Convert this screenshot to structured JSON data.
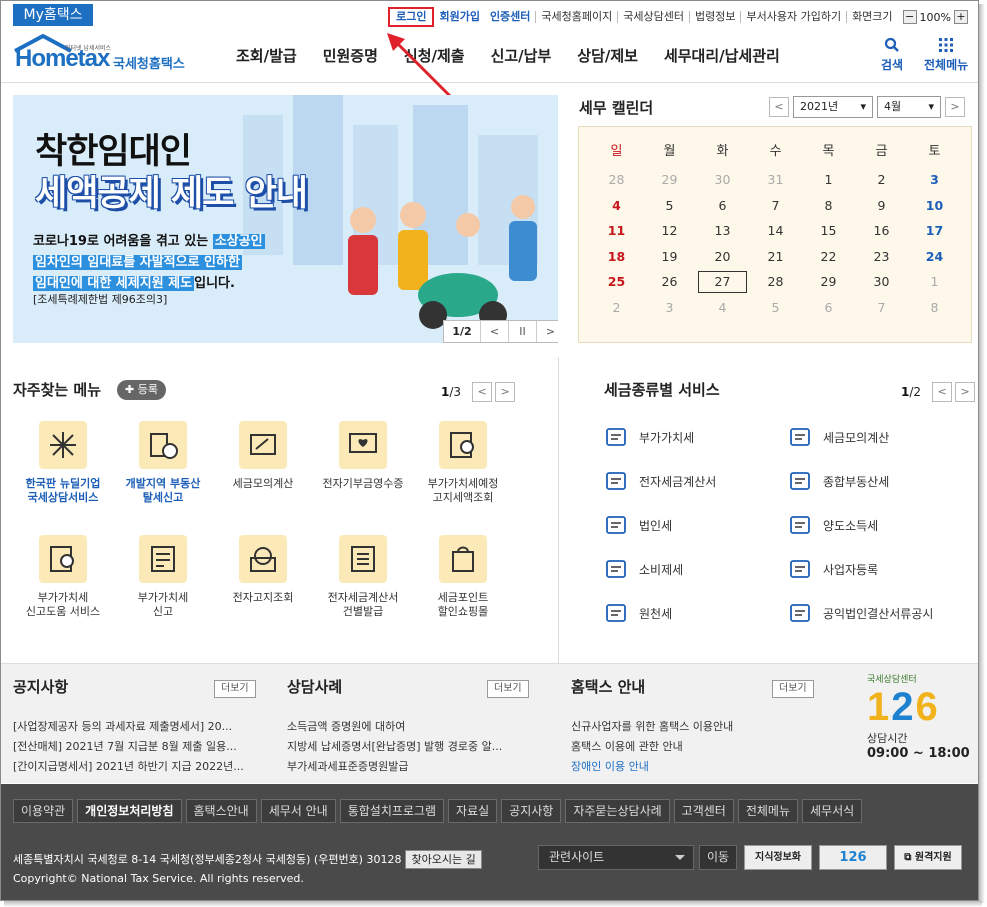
{
  "util": {
    "my_home": "My홈택스",
    "login": "로그인",
    "signup": "회원가입",
    "cert_center": "인증센터",
    "links": [
      "국세청홈페이지",
      "국세상담센터",
      "법령정보",
      "부서사용자 가입하기",
      "화면크기"
    ],
    "zoom": "100%"
  },
  "logo": {
    "brand": "Hometax",
    "sub": "국세청홈택스",
    "tiny": "인터넷 납세서비스"
  },
  "nav": [
    "조회/발급",
    "민원증명",
    "신청/제출",
    "신고/납부",
    "상담/제보",
    "세무대리/납세관리"
  ],
  "header_icons": {
    "search": "검색",
    "all_menu": "전체메뉴"
  },
  "banner": {
    "title1": "착한임대인",
    "title2": "세액공제 제도 안내",
    "line1a": "코로나19로 어려움을 겪고 있는 ",
    "line1b": "소상공인",
    "line2": "임차인의 임대료를 자발적으로 인하한",
    "line3a": "임대인에 대한 세제지원 제도",
    "line3b": "입니다.",
    "law": "[조세특례제한법 제96조의3]",
    "page": "1/2"
  },
  "calendar": {
    "title": "세무 캘린더",
    "year": "2021년",
    "month": "4월",
    "weekdays": [
      "일",
      "월",
      "화",
      "수",
      "목",
      "금",
      "토"
    ],
    "days": [
      [
        "28",
        "29",
        "30",
        "31",
        "1",
        "2",
        "3"
      ],
      [
        "4",
        "5",
        "6",
        "7",
        "8",
        "9",
        "10"
      ],
      [
        "11",
        "12",
        "13",
        "14",
        "15",
        "16",
        "17"
      ],
      [
        "18",
        "19",
        "20",
        "21",
        "22",
        "23",
        "24"
      ],
      [
        "25",
        "26",
        "27",
        "28",
        "29",
        "30",
        "1"
      ],
      [
        "2",
        "3",
        "4",
        "5",
        "6",
        "7",
        "8"
      ]
    ],
    "today": "27"
  },
  "freq": {
    "title": "자주찾는 메뉴",
    "add": "등록",
    "page_cur": "1",
    "page_total": "/3",
    "items": [
      "한국판 뉴딜기업\n국세상담서비스",
      "개발지역 부동산\n탈세신고",
      "세금모의계산",
      "전자기부금영수증",
      "부가가치세예정\n고지세액조회",
      "부가가치세\n신고도움 서비스",
      "부가가치세\n신고",
      "전자고지조회",
      "전자세금계산서\n건별발급",
      "세금포인트\n할인쇼핑몰"
    ]
  },
  "tax": {
    "title": "세금종류별 서비스",
    "page_cur": "1",
    "page_total": "/2",
    "left": [
      "부가가치세",
      "전자세금계산서",
      "법인세",
      "소비제세",
      "원천세"
    ],
    "right": [
      "세금모의계산",
      "종합부동산세",
      "양도소득세",
      "사업자등록",
      "공익법인결산서류공시"
    ]
  },
  "notice": {
    "title": "공지사항",
    "more": "더보기",
    "items": [
      "[사업장제공자 등의 과세자료 제출명세서] 20...",
      "[전산매체] 2021년 7월 지급분 8월 제출 일용...",
      "[간이지급명세서] 2021년 하반기 지급 2022년..."
    ]
  },
  "cases": {
    "title": "상담사례",
    "more": "더보기",
    "items": [
      "소득금액 증명원에 대하여",
      "지방세 납세증명서[완납증명] 발행 경로중 알...",
      "부가세과세표준증명원발급"
    ]
  },
  "guide": {
    "title": "홈택스 안내",
    "more": "더보기",
    "items": [
      "신규사업자를 위한 홈택스 이용안내",
      "홈택스 이용에 관한 안내",
      "장애인 이용 안내"
    ]
  },
  "center": {
    "small": "국세상담센터",
    "num_a": "1",
    "num_b": "2",
    "num_c": "6",
    "hours_label": "상담시간",
    "hours": "09:00 ~ 18:00"
  },
  "footer": {
    "links": [
      "이용약관",
      "개인정보처리방침",
      "홈택스안내",
      "세무서 안내",
      "통합설치프로그램",
      "자료실",
      "공지사항",
      "자주묻는상담사례",
      "고객센터",
      "전체메뉴",
      "세무서식"
    ],
    "address": "세종특별자치시 국세청로 8-14 국세청(정부세종2청사 국세청동) (우편번호) 30128",
    "find": "찾아오시는 길",
    "copyright": "Copyright© National Tax Service. All rights reserved.",
    "related": "관련사이트",
    "go": "이동",
    "btn1": "지식정보화",
    "btn2": "126",
    "btn3": "원격지원"
  },
  "colors": {
    "brand_blue": "#1d6fc2",
    "accent_red": "#e0202a",
    "banner_bg": "#d9ecfa",
    "footer_bg": "#4a4a4a"
  }
}
